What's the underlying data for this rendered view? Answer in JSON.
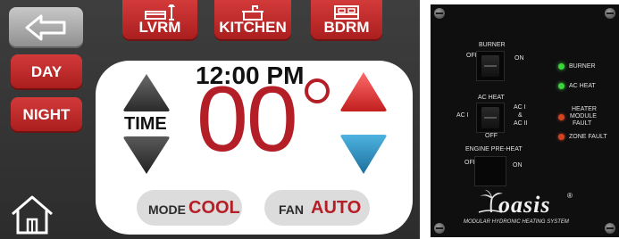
{
  "thermostat": {
    "rooms": [
      {
        "label": "LVRM",
        "icon": "sofa-lamp-icon"
      },
      {
        "label": "KITCHEN",
        "icon": "kitchen-sink-icon"
      },
      {
        "label": "BDRM",
        "icon": "bed-icon"
      }
    ],
    "back_icon": "back-arrow-icon",
    "day_label": "DAY",
    "night_label": "NIGHT",
    "home_icon": "home-icon",
    "clock": "12:00 PM",
    "time_label": "TIME",
    "temperature": "00",
    "mode_label": "MODE",
    "mode_value": "COOL",
    "fan_label": "FAN",
    "fan_value": "AUTO",
    "colors": {
      "accent_red": "#b41e26",
      "button_red": "#c62a2a",
      "up_arrow": "#e23a3a",
      "down_arrow": "#3a9ccc"
    }
  },
  "oasis_panel": {
    "burner": {
      "title": "BURNER",
      "off": "OFF",
      "on": "ON"
    },
    "ac_heat": {
      "title": "AC HEAT",
      "left": "AC I",
      "right": [
        "AC I",
        "&",
        "AC II"
      ],
      "bottom": "OFF"
    },
    "engine": {
      "title": "ENGINE PRE-HEAT",
      "off": "OFF",
      "on": "ON"
    },
    "indicators": [
      {
        "label": "BURNER",
        "color": "#3bd43b"
      },
      {
        "label": "AC HEAT",
        "color": "#3bd43b"
      },
      {
        "label_lines": [
          "HEATER",
          "MODULE",
          "FAULT"
        ],
        "color": "#d2441f"
      },
      {
        "label": "ZONE FAULT",
        "color": "#d2441f"
      }
    ],
    "brand": "oasis",
    "trademark": "®",
    "tagline": "MODULAR HYDRONIC HEATING SYSTEM"
  }
}
